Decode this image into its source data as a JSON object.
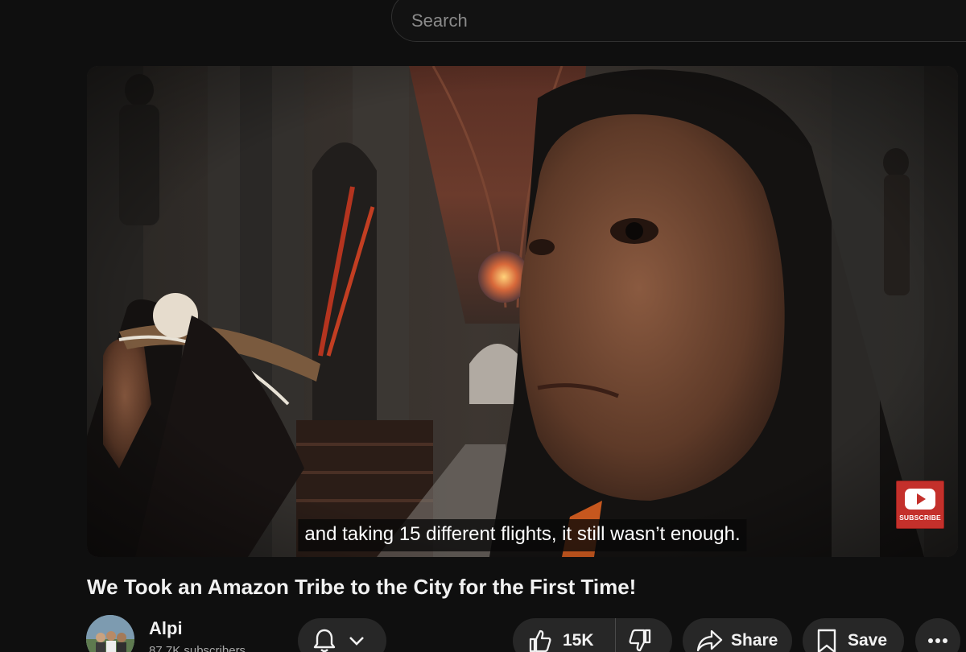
{
  "search": {
    "placeholder": "Search"
  },
  "player": {
    "caption": "and taking 15 different flights, it still wasn’t enough.",
    "watermark_label": "SUBSCRIBE"
  },
  "video": {
    "title": "We Took an Amazon Tribe to the City for the First Time!"
  },
  "channel": {
    "name": "Alpi",
    "subscribers": "87.7K subscribers"
  },
  "actions": {
    "likes": "15K",
    "share_label": "Share",
    "save_label": "Save"
  },
  "colors": {
    "background": "#0f0f0f",
    "button": "#272727",
    "accent": "#c4302b"
  }
}
